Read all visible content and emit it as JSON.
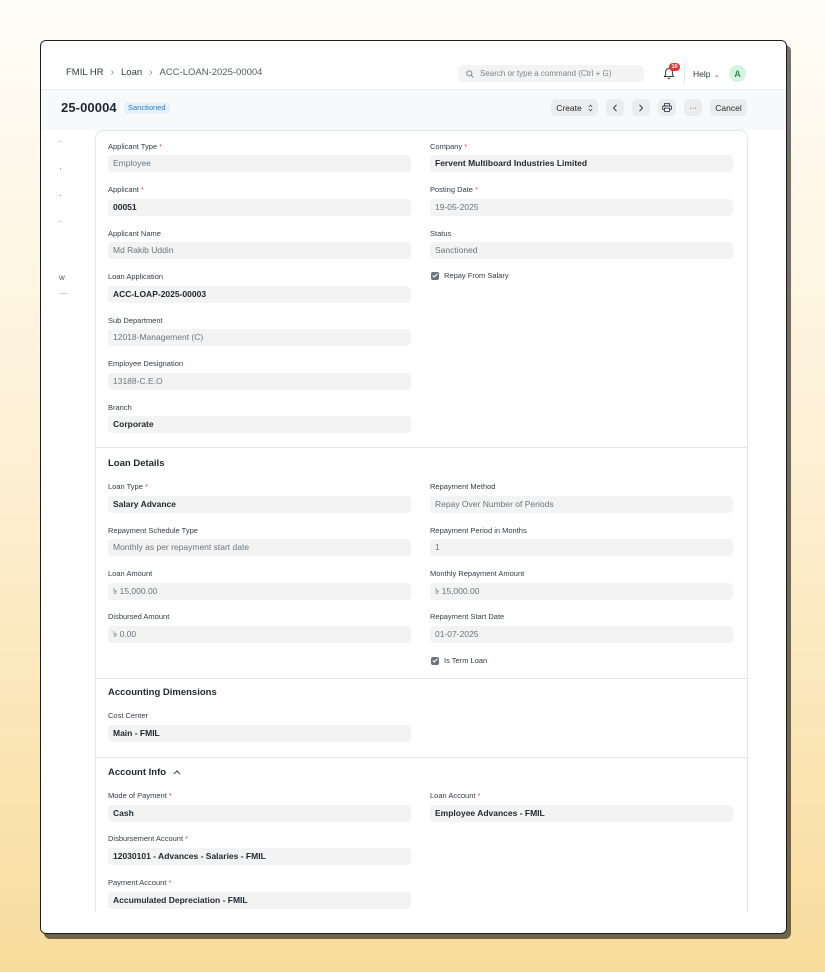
{
  "navbar": {
    "breadcrumbs": [
      "FMIL HR",
      "Loan",
      "ACC-LOAN-2025-00004"
    ],
    "search_placeholder": "Search or type a command (Ctrl + G)",
    "notification_count": "10",
    "help_label": "Help",
    "avatar_initial": "A"
  },
  "header": {
    "title": "25-00004",
    "status": "Sanctioned",
    "create_label": "Create",
    "more_label": "···",
    "cancel_label": "Cancel"
  },
  "sidebar": {
    "peek_text": "w"
  },
  "form": {
    "applicant_type": {
      "label": "Applicant Type",
      "value": "Employee"
    },
    "company": {
      "label": "Company",
      "value": "Fervent Multiboard Industries Limited"
    },
    "applicant": {
      "label": "Applicant",
      "value": "00051"
    },
    "posting_date": {
      "label": "Posting Date",
      "value": "19-05-2025"
    },
    "applicant_name": {
      "label": "Applicant Name",
      "value": "Md Rakib Uddin"
    },
    "status": {
      "label": "Status",
      "value": "Sanctioned"
    },
    "repay_from_salary": {
      "label": "Repay From Salary",
      "checked": true
    },
    "loan_application": {
      "label": "Loan Application",
      "value": "ACC-LOAP-2025-00003"
    },
    "sub_department": {
      "label": "Sub Department",
      "value": "12018-Management (C)"
    },
    "employee_designation": {
      "label": "Employee Designation",
      "value": "13188-C.E.O"
    },
    "branch": {
      "label": "Branch",
      "value": "Corporate"
    }
  },
  "loan_details": {
    "title": "Loan Details",
    "loan_type": {
      "label": "Loan Type",
      "value": "Salary Advance"
    },
    "repayment_method": {
      "label": "Repayment Method",
      "value": "Repay Over Number of Periods"
    },
    "repayment_schedule_type": {
      "label": "Repayment Schedule Type",
      "value": "Monthly as per repayment start date"
    },
    "repayment_period": {
      "label": "Repayment Period in Months",
      "value": "1"
    },
    "loan_amount": {
      "label": "Loan Amount",
      "value": "৳ 15,000.00"
    },
    "monthly_repayment_amount": {
      "label": "Monthly Repayment Amount",
      "value": "৳ 15,000.00"
    },
    "disbursed_amount": {
      "label": "Disbursed Amount",
      "value": "৳ 0.00"
    },
    "repayment_start_date": {
      "label": "Repayment Start Date",
      "value": "01-07-2025"
    },
    "is_term_loan": {
      "label": "Is Term Loan",
      "checked": true
    }
  },
  "accounting_dimensions": {
    "title": "Accounting Dimensions",
    "cost_center": {
      "label": "Cost Center",
      "value": "Main - FMIL"
    }
  },
  "account_info": {
    "title": "Account Info",
    "mode_of_payment": {
      "label": "Mode of Payment",
      "value": "Cash"
    },
    "loan_account": {
      "label": "Loan Account",
      "value": "Employee Advances - FMIL"
    },
    "disbursement_account": {
      "label": "Disbursement Account",
      "value": "12030101 - Advances - Salaries - FMIL"
    },
    "payment_account": {
      "label": "Payment Account",
      "value": "Accumulated Depreciation - FMIL"
    }
  },
  "colors": {
    "accent": "#2f7ac0",
    "required": "#e24c4c",
    "avatar_bg": "#d6f3e0",
    "badge": "#e03636"
  }
}
